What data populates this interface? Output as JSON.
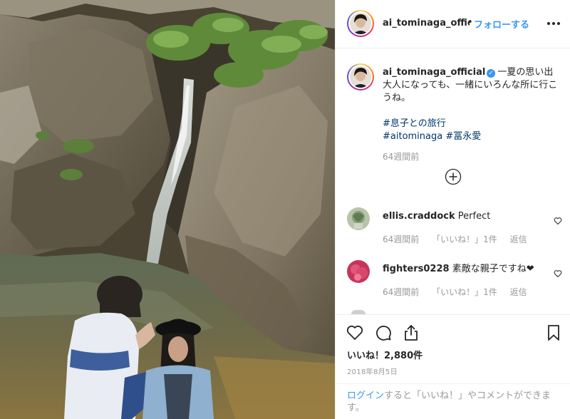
{
  "post": {
    "username": "ai_tominaga_official",
    "header_separator": "•",
    "follow_label": "フォローする",
    "verified_glyph": "✓",
    "caption_lines": [
      "一夏の思い出",
      "大人になっても、一緒にいろんな所に行こうね。"
    ],
    "hashtags": {
      "line1": "#息子との旅行",
      "line2a": "#aitominaga",
      "line2b": "#冨永愛"
    },
    "caption_time": "64週間前"
  },
  "comments": [
    {
      "user": "ellis.craddock",
      "text": "Perfect",
      "time": "64週間前",
      "like_label": "「いいね！」1件",
      "reply_label": "返信"
    },
    {
      "user": "fighters0228",
      "text": "素敵な親子ですね❤",
      "time": "64週間前",
      "like_label": "「いいね！」1件",
      "reply_label": "返信"
    }
  ],
  "actions": {
    "likes_text": "いいね！2,880件",
    "date_text": "2018年8月5日",
    "login_link": "ログイン",
    "login_rest": "すると「いいね！」やコメントができます。"
  },
  "icons": {
    "more": "more-options-icon",
    "load_more": "plus-circle-icon",
    "like": "heart-icon",
    "comment": "comment-bubble-icon",
    "share": "share-icon",
    "save": "bookmark-icon"
  },
  "colors": {
    "accent": "#3897f0",
    "hashtag": "#003569",
    "muted": "#999999",
    "text": "#262626"
  }
}
